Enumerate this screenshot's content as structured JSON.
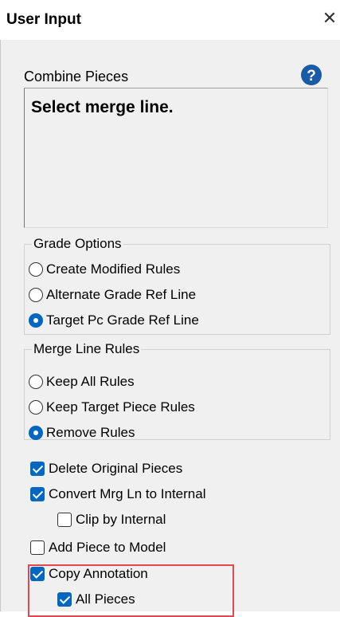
{
  "window": {
    "title": "User Input",
    "close_glyph": "✕"
  },
  "header": {
    "section": "Combine Pieces",
    "help_icon": "question-circle-icon"
  },
  "prompt": {
    "text": "Select merge line."
  },
  "grade_options": {
    "label": "Grade Options",
    "options": [
      {
        "label": "Create Modified Rules",
        "selected": false
      },
      {
        "label": "Alternate Grade Ref Line",
        "selected": false
      },
      {
        "label": "Target Pc Grade Ref Line",
        "selected": true
      }
    ]
  },
  "merge_line_rules": {
    "label": "Merge Line Rules",
    "options": [
      {
        "label": "Keep All Rules",
        "selected": false
      },
      {
        "label": "Keep Target Piece Rules",
        "selected": false
      },
      {
        "label": "Remove Rules",
        "selected": true
      }
    ]
  },
  "checkboxes": [
    {
      "label": "Delete Original Pieces",
      "checked": true
    },
    {
      "label": "Convert Mrg Ln to Internal",
      "checked": true
    },
    {
      "label": "Clip by Internal",
      "checked": false
    },
    {
      "label": "Add Piece to Model",
      "checked": false
    },
    {
      "label": "Copy Annotation",
      "checked": true
    },
    {
      "label": "All Pieces",
      "checked": true
    }
  ],
  "colors": {
    "accent": "#0067c0",
    "highlight": "#e0484d",
    "panel_bg": "#f0f0f0"
  }
}
